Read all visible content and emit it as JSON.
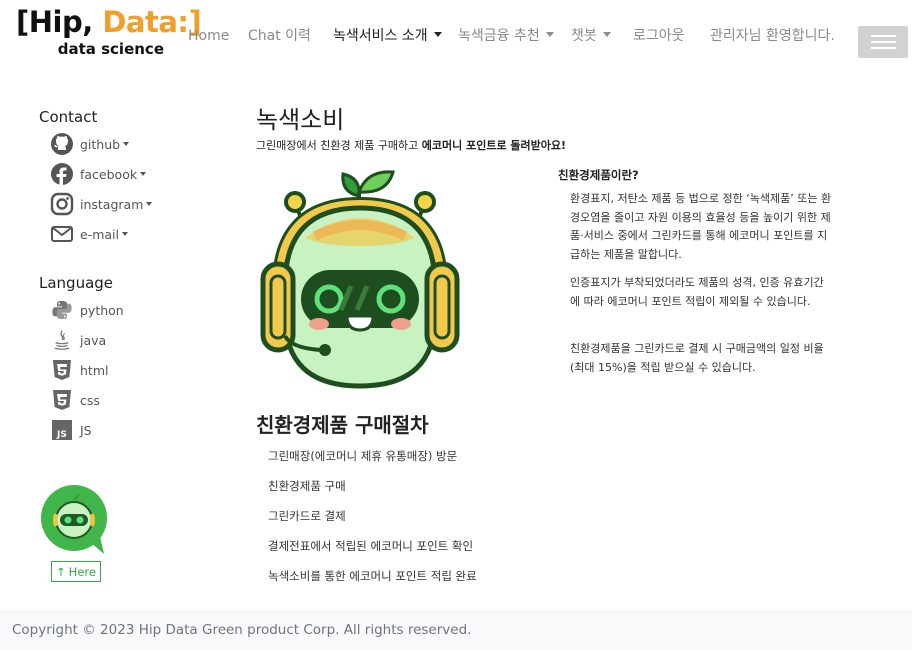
{
  "brand": {
    "line1_a": "[Hip, ",
    "line1_b": "Data:]",
    "line2": "data science"
  },
  "nav": {
    "home": "Home",
    "chat": "Chat 이력",
    "green_service": "녹색서비스 소개",
    "green_finance": "녹색금융 추천",
    "chatbot": "챗봇",
    "logout": "로그아웃",
    "welcome": "관리자님 환영합니다."
  },
  "sidebar": {
    "contact_heading": "Contact",
    "contact": [
      {
        "label": "github",
        "icon": "github-icon"
      },
      {
        "label": "facebook",
        "icon": "facebook-icon"
      },
      {
        "label": "instagram",
        "icon": "instagram-icon"
      },
      {
        "label": "e-mail",
        "icon": "envelope-icon"
      }
    ],
    "language_heading": "Language",
    "languages": [
      {
        "label": "python",
        "icon": "python-icon"
      },
      {
        "label": "java",
        "icon": "java-icon"
      },
      {
        "label": "html",
        "icon": "html5-icon"
      },
      {
        "label": "css",
        "icon": "css3-icon"
      },
      {
        "label": "JS",
        "icon": "js-icon"
      }
    ],
    "here_button": "Here"
  },
  "main": {
    "title": "녹색소비",
    "subtitle_plain": "그린매장에서 친환경 제품 구매하고 ",
    "subtitle_bold": "에코머니 포인트로 돌려받아요!",
    "right_heading": "친환경제품이란?",
    "paragraphs": [
      "환경표지, 저탄소 제품 등 법으로 정한 ‘녹색제품’ 또는 환경오염을 줄이고 자원 이용의 효율성 등을 높이기 위한 제품·서비스 중에서 그린카드를 통해 에코머니 포인트를 지급하는 제품을 말합니다.",
      "인증표지가 부착되었더라도 제품의 성격, 인증 유효기간에 따라 에코머니 포인트 적립이 제외될 수 있습니다.",
      "친환경제품을 그린카드로 결제 시 구매금액의 일정 비율(최대 15%)을 적립 받으실 수 있습니다."
    ],
    "procedure_title": "친환경제품 구매절차",
    "steps": [
      "그린매장(에코머니 제휴 유통매장) 방문",
      "친환경제품 구매",
      "그린카드로 결제",
      "결제전표에서 적립된 에코머니 포인트 확인",
      "녹색소비를 통한 에코머니 포인트 적립 완료"
    ]
  },
  "footer": {
    "copyright": "Copyright © 2023 Hip Data Green product Corp. All rights reserved."
  },
  "colors": {
    "brand_orange": "#f0a02a",
    "green": "#3aa84a",
    "footer_bg": "#f8f9fa",
    "nav_muted": "#8a8a8a"
  }
}
